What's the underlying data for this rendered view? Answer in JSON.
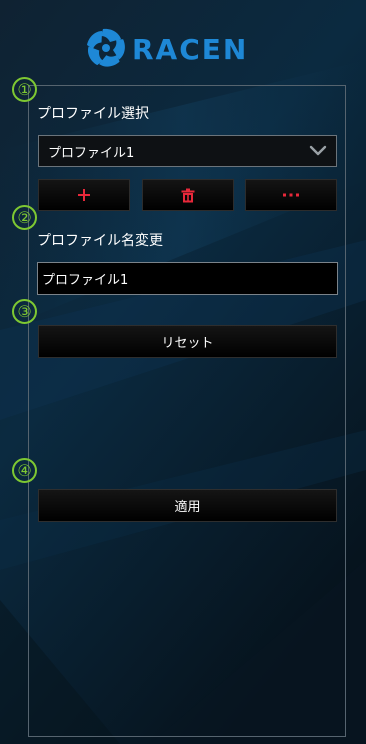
{
  "logo": {
    "text": "RACEN",
    "icon": "racen-logo-icon",
    "color": "#1e88d6"
  },
  "markers": [
    "①",
    "②",
    "③",
    "④"
  ],
  "profile_select": {
    "label": "プロファイル選択",
    "value": "プロファイル1",
    "dropdown_icon": "chevron-down-icon"
  },
  "profile_actions": {
    "add_icon": "plus-icon",
    "delete_icon": "trash-icon",
    "more_icon": "ellipsis-icon",
    "icon_color": "#e8283a"
  },
  "profile_rename": {
    "label": "プロファイル名変更",
    "value": "プロファイル1"
  },
  "reset_button": "リセット",
  "apply_button": "適用",
  "colors": {
    "marker": "#7ec832",
    "panel_border": "#56646f",
    "accent_red": "#e8283a"
  }
}
